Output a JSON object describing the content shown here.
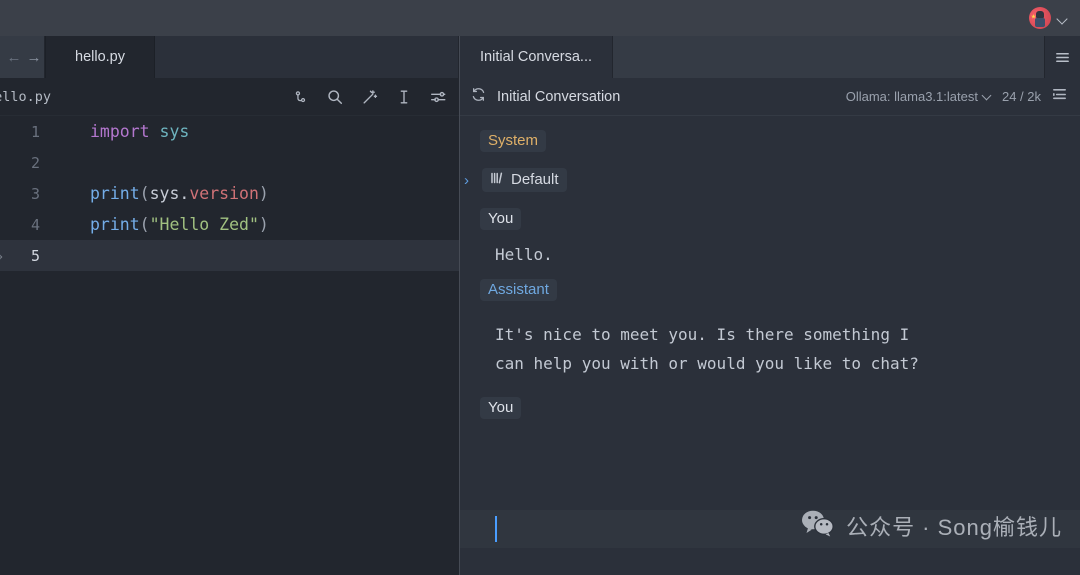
{
  "titlebar": {
    "avatar_name": "user-avatar",
    "chevron": "▾"
  },
  "editor": {
    "nav_back": "←",
    "nav_forward": "→",
    "tabs": [
      {
        "label": "hello.py",
        "active": true
      }
    ],
    "breadcrumb": "hello.py",
    "toolbar_icons": [
      "git-branch-icon",
      "search-icon",
      "magic-wand-icon",
      "text-cursor-icon",
      "settings-sliders-icon"
    ],
    "lines": [
      {
        "number": "1",
        "tokens": [
          {
            "t": "import",
            "c": "k-import"
          },
          {
            "t": " ",
            "c": "k-plain"
          },
          {
            "t": "sys",
            "c": "k-mod"
          }
        ]
      },
      {
        "number": "2",
        "tokens": []
      },
      {
        "number": "3",
        "tokens": [
          {
            "t": "print",
            "c": "k-fn"
          },
          {
            "t": "(",
            "c": "k-punc"
          },
          {
            "t": "sys",
            "c": "k-plain"
          },
          {
            "t": ".",
            "c": "k-plain"
          },
          {
            "t": "version",
            "c": "k-prop"
          },
          {
            "t": ")",
            "c": "k-punc"
          }
        ]
      },
      {
        "number": "4",
        "tokens": [
          {
            "t": "print",
            "c": "k-fn"
          },
          {
            "t": "(",
            "c": "k-punc"
          },
          {
            "t": "\"Hello Zed\"",
            "c": "k-str"
          },
          {
            "t": ")",
            "c": "k-punc"
          }
        ]
      },
      {
        "number": "5",
        "tokens": [],
        "active": true,
        "fold": "⤷"
      }
    ]
  },
  "assistant": {
    "tab_label": "Initial Conversa...",
    "menu_icon": "hamburger-menu-icon",
    "refresh_icon": "refresh-icon",
    "title": "Initial Conversation",
    "model": "Ollama: llama3.1:latest",
    "tokens": "24 / 2k",
    "history_icon": "conversation-history-icon",
    "messages": [
      {
        "kind": "badge",
        "role": "System",
        "style": "system"
      },
      {
        "kind": "prompt",
        "chevron": "›",
        "glyph": "lll\\",
        "label": "Default"
      },
      {
        "kind": "badge",
        "role": "You",
        "style": "you"
      },
      {
        "kind": "text",
        "body": "Hello."
      },
      {
        "kind": "badge",
        "role": "Assistant",
        "style": "assistant"
      },
      {
        "kind": "text",
        "body": "It's nice to meet you. Is there something I\ncan help you with or would you like to chat?"
      },
      {
        "kind": "badge",
        "role": "You",
        "style": "you"
      }
    ],
    "composer_value": ""
  },
  "watermark": {
    "text": "公众号 · Song榆钱儿",
    "icon": "wechat-logo-icon"
  },
  "colors": {
    "titlebar_bg": "#3b4049",
    "editor_bg": "#22262e",
    "panel_bg": "#2b303a",
    "accent_blue": "#6fa8e0",
    "system_amber": "#dfb068",
    "caret_blue": "#4a9eff"
  }
}
